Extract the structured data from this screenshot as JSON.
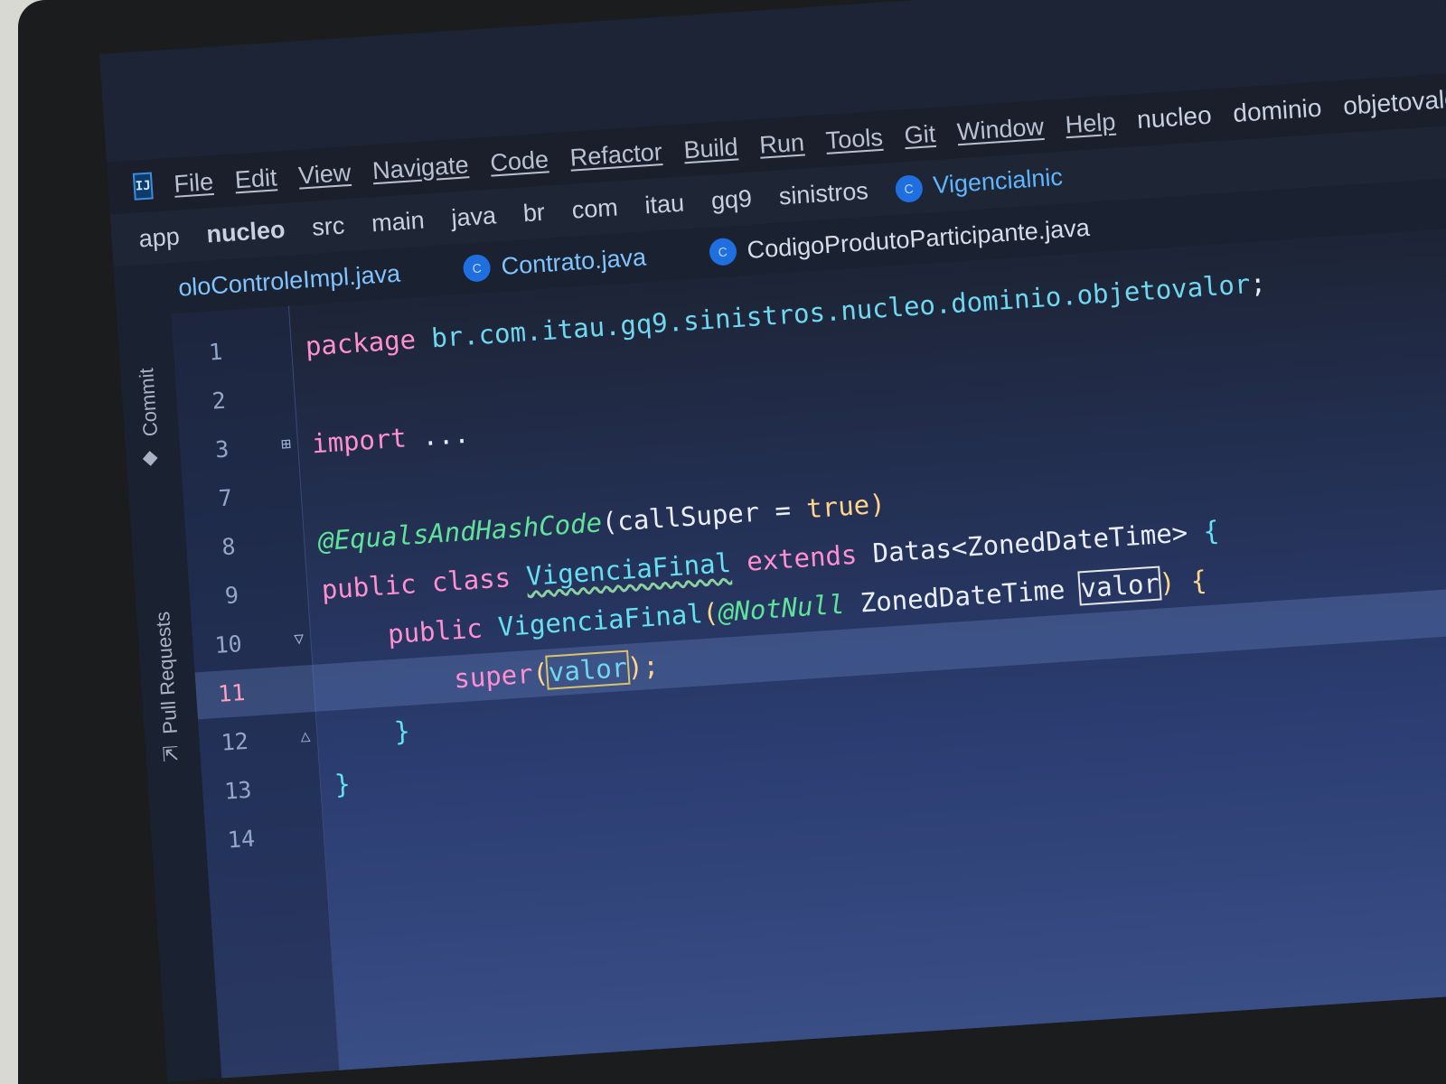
{
  "menu": {
    "logo": "IJ",
    "items": [
      "File",
      "Edit",
      "View",
      "Navigate",
      "Code",
      "Refactor",
      "Build",
      "Run",
      "Tools",
      "Git",
      "Window",
      "Help"
    ]
  },
  "breadcrumb": {
    "items": [
      "app",
      "nucleo",
      "src",
      "main",
      "java",
      "br",
      "com",
      "itau",
      "gq9",
      "sinistros",
      "nucleo",
      "dominio",
      "objetovalor"
    ],
    "current_file": "Vigencialnic"
  },
  "tabs": [
    {
      "label": "oloControleImpl.java",
      "active": false
    },
    {
      "label": "Contrato.java",
      "active": false
    },
    {
      "label": "CodigoProdutoParticipante.java",
      "active": false
    }
  ],
  "tool_windows": {
    "commit": "Commit",
    "pull_requests": "Pull Requests"
  },
  "editor": {
    "current_line": "11",
    "lines": [
      {
        "n": "1",
        "tokens": [
          {
            "t": "package ",
            "c": "kw"
          },
          {
            "t": "br.com.itau.gq9.sinistros.nucleo.dominio.objetovalor",
            "c": "pkg"
          },
          {
            "t": ";",
            "c": "plain"
          }
        ]
      },
      {
        "n": "2",
        "tokens": []
      },
      {
        "n": "3",
        "tokens": [
          {
            "t": "import ",
            "c": "kw"
          },
          {
            "t": "...",
            "c": "plain"
          }
        ]
      },
      {
        "n": "7",
        "tokens": []
      },
      {
        "n": "8",
        "tokens": [
          {
            "t": "@EqualsAndHashCode",
            "c": "ann"
          },
          {
            "t": "(callSuper = ",
            "c": "plain"
          },
          {
            "t": "true",
            "c": "str"
          },
          {
            "t": ")",
            "c": "str"
          }
        ]
      },
      {
        "n": "9",
        "tokens": [
          {
            "t": "public class ",
            "c": "kw"
          },
          {
            "t": "VigenciaFinal",
            "c": "meth"
          },
          {
            "t": " extends ",
            "c": "kw"
          },
          {
            "t": "Datas<ZonedDateTime>",
            "c": "plain"
          },
          {
            "t": " {",
            "c": "meth"
          }
        ]
      },
      {
        "n": "10",
        "tokens": [
          {
            "t": "    public ",
            "c": "kw"
          },
          {
            "t": "VigenciaFinal",
            "c": "meth"
          },
          {
            "t": "(",
            "c": "str"
          },
          {
            "t": "@NotNull",
            "c": "ann"
          },
          {
            "t": " ZonedDateTime ",
            "c": "plain"
          },
          {
            "t": "valor",
            "c": "plain"
          },
          {
            "t": ") {",
            "c": "str"
          }
        ]
      },
      {
        "n": "11",
        "tokens": [
          {
            "t": "        super",
            "c": "kw"
          },
          {
            "t": "(",
            "c": "str"
          },
          {
            "t": "valor",
            "c": "pkg"
          },
          {
            "t": ");",
            "c": "str"
          }
        ]
      },
      {
        "n": "12",
        "tokens": [
          {
            "t": "    }",
            "c": "meth"
          }
        ]
      },
      {
        "n": "13",
        "tokens": [
          {
            "t": "}",
            "c": "meth"
          }
        ]
      },
      {
        "n": "14",
        "tokens": []
      }
    ]
  }
}
